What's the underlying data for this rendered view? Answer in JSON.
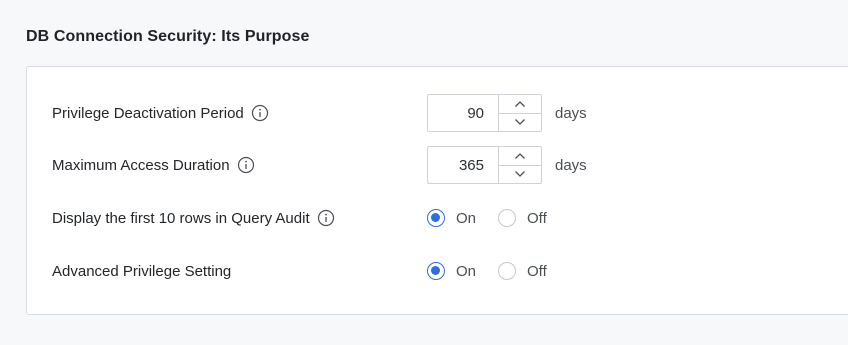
{
  "section": {
    "title": "DB Connection Security: Its Purpose"
  },
  "settings": [
    {
      "label": "Privilege Deactivation Period",
      "has_info": true,
      "type": "stepper",
      "value": "90",
      "unit": "days"
    },
    {
      "label": "Maximum Access Duration",
      "has_info": true,
      "type": "stepper",
      "value": "365",
      "unit": "days"
    },
    {
      "label": "Display the first 10 rows in Query Audit",
      "has_info": true,
      "type": "radio",
      "options": [
        "On",
        "Off"
      ],
      "selected": "On"
    },
    {
      "label": "Advanced Privilege Setting",
      "has_info": false,
      "type": "radio",
      "options": [
        "On",
        "Off"
      ],
      "selected": "On"
    }
  ],
  "icons": {
    "info": "info-icon",
    "increment": "chevron-up-icon",
    "decrement": "chevron-down-icon"
  },
  "colors": {
    "accent": "#2f6fd1",
    "border": "#d9dce0",
    "background": "#f7f8f9",
    "panel": "#ffffff"
  }
}
